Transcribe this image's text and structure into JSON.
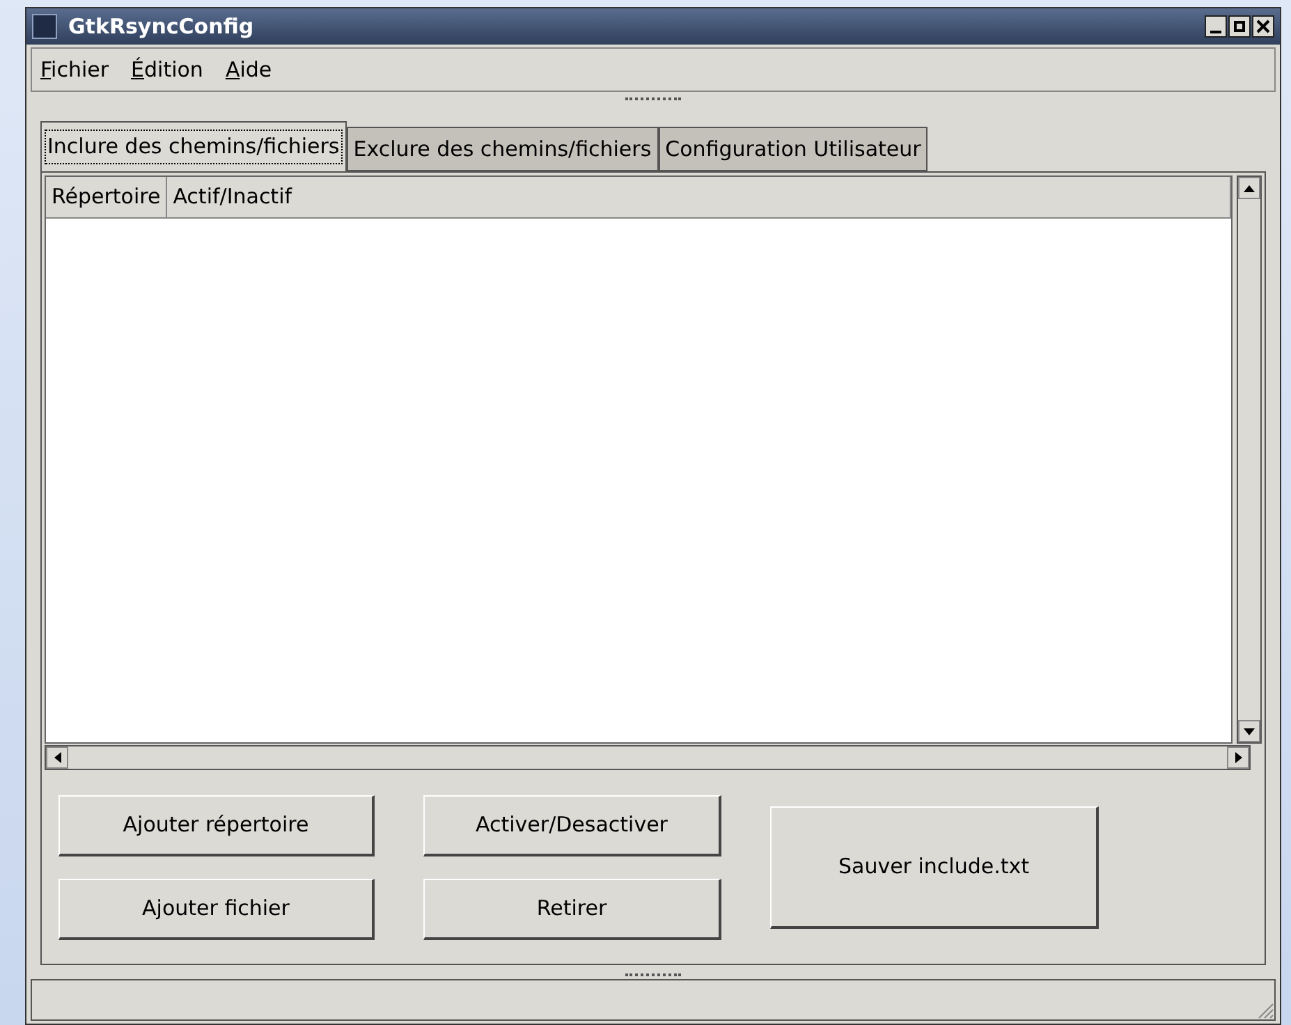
{
  "window": {
    "title": "GtkRsyncConfig"
  },
  "menu": [
    "Fichier",
    "Édition",
    "Aide"
  ],
  "tabs": [
    {
      "label": "Inclure des chemins/fichiers",
      "selected": true
    },
    {
      "label": "Exclure des chemins/fichiers",
      "selected": false
    },
    {
      "label": "Configuration Utilisateur",
      "selected": false
    }
  ],
  "table": {
    "columns": [
      "Répertoire",
      "Actif/Inactif"
    ]
  },
  "buttons": [
    {
      "label": "Ajouter répertoire",
      "kind": "small"
    },
    {
      "label": "Activer/Desactiver",
      "kind": "small"
    },
    {
      "label": "Ajouter fichier",
      "kind": "small"
    },
    {
      "label": "Retirer",
      "kind": "small"
    },
    {
      "label": "Sauver include.txt",
      "kind": "large"
    }
  ]
}
